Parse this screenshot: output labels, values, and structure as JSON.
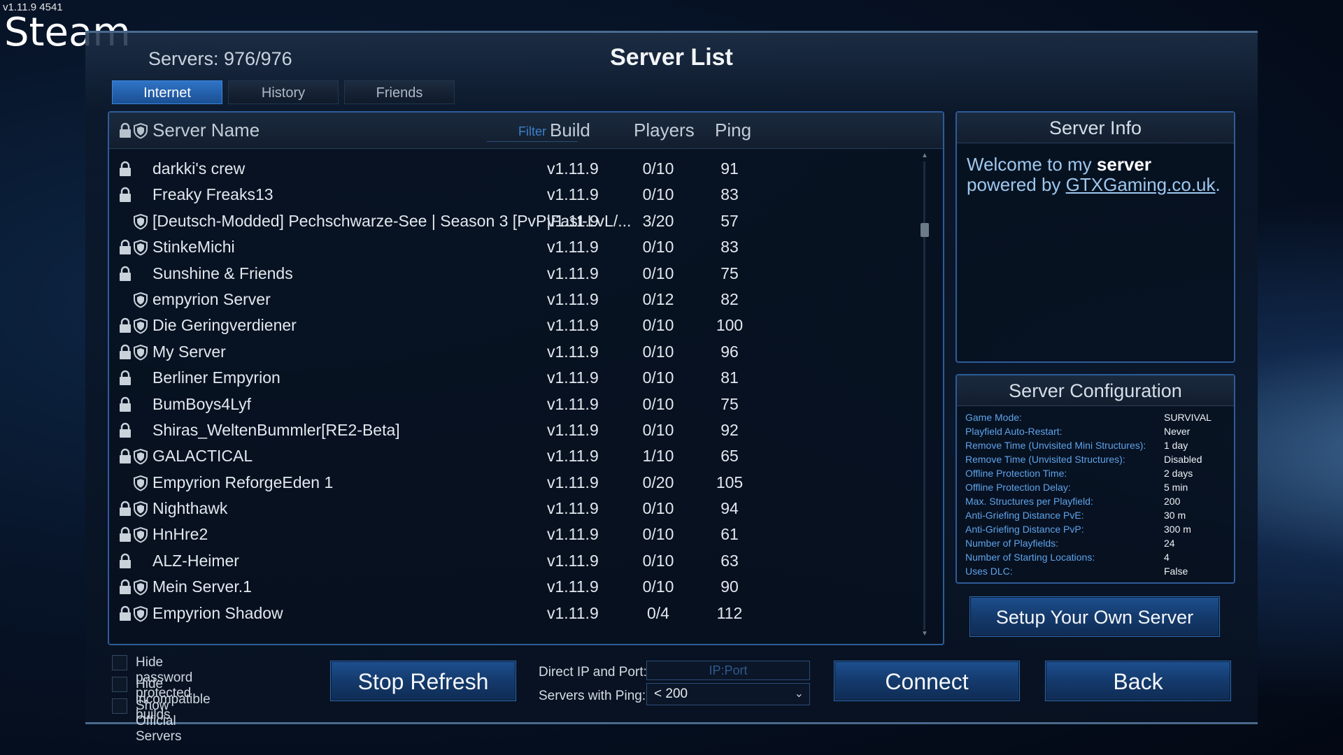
{
  "app": {
    "version": "v1.11.9 4541",
    "overlay_title": "Steam"
  },
  "header": {
    "servers_count": "Servers: 976/976",
    "title": "Server List"
  },
  "tabs": [
    {
      "label": "Internet",
      "active": true
    },
    {
      "label": "History",
      "active": false
    },
    {
      "label": "Friends",
      "active": false
    }
  ],
  "list": {
    "columns": {
      "name": "Server Name",
      "filter_placeholder": "Filter",
      "build": "Build",
      "players": "Players",
      "ping": "Ping"
    },
    "rows": [
      {
        "locked": true,
        "shield": false,
        "name": "darkki's crew",
        "build": "v1.11.9",
        "players": "0/10",
        "ping": "91"
      },
      {
        "locked": true,
        "shield": false,
        "name": "Freaky Freaks13",
        "build": "v1.11.9",
        "players": "0/10",
        "ping": "83"
      },
      {
        "locked": false,
        "shield": true,
        "name": "[Deutsch-Modded] Pechschwarze-See | Season 3 [PvP|Fast-LvL/...",
        "build": "v1.11.9",
        "players": "3/20",
        "ping": "57"
      },
      {
        "locked": true,
        "shield": true,
        "name": "StinkeMichi",
        "build": "v1.11.9",
        "players": "0/10",
        "ping": "83"
      },
      {
        "locked": true,
        "shield": false,
        "name": "Sunshine & Friends",
        "build": "v1.11.9",
        "players": "0/10",
        "ping": "75"
      },
      {
        "locked": false,
        "shield": true,
        "name": "empyrion Server",
        "build": "v1.11.9",
        "players": "0/12",
        "ping": "82"
      },
      {
        "locked": true,
        "shield": true,
        "name": "Die Geringverdiener",
        "build": "v1.11.9",
        "players": "0/10",
        "ping": "100"
      },
      {
        "locked": true,
        "shield": true,
        "name": "My Server",
        "build": "v1.11.9",
        "players": "0/10",
        "ping": "96"
      },
      {
        "locked": true,
        "shield": false,
        "name": "Berliner Empyrion",
        "build": "v1.11.9",
        "players": "0/10",
        "ping": "81"
      },
      {
        "locked": true,
        "shield": false,
        "name": "BumBoys4Lyf",
        "build": "v1.11.9",
        "players": "0/10",
        "ping": "75"
      },
      {
        "locked": true,
        "shield": false,
        "name": "Shiras_WeltenBummler[RE2-Beta]",
        "build": "v1.11.9",
        "players": "0/10",
        "ping": "92"
      },
      {
        "locked": true,
        "shield": true,
        "name": "GALACTICAL",
        "build": "v1.11.9",
        "players": "1/10",
        "ping": "65"
      },
      {
        "locked": false,
        "shield": true,
        "name": "Empyrion ReforgeEden 1",
        "build": "v1.11.9",
        "players": "0/20",
        "ping": "105"
      },
      {
        "locked": true,
        "shield": true,
        "name": "Nighthawk",
        "build": "v1.11.9",
        "players": "0/10",
        "ping": "94"
      },
      {
        "locked": true,
        "shield": true,
        "name": "HnHre2",
        "build": "v1.11.9",
        "players": "0/10",
        "ping": "61"
      },
      {
        "locked": true,
        "shield": false,
        "name": "ALZ-Heimer",
        "build": "v1.11.9",
        "players": "0/10",
        "ping": "63"
      },
      {
        "locked": true,
        "shield": true,
        "name": "Mein Server.1",
        "build": "v1.11.9",
        "players": "0/10",
        "ping": "90"
      },
      {
        "locked": true,
        "shield": true,
        "name": "Empyrion Shadow",
        "build": "v1.11.9",
        "players": "0/4",
        "ping": "112"
      }
    ]
  },
  "server_info": {
    "title": "Server Info",
    "welcome_pre": "Welcome to my ",
    "welcome_bold": "server",
    "welcome_mid": " powered by ",
    "welcome_link": "GTXGaming.co.uk",
    "welcome_post": "."
  },
  "server_config": {
    "title": "Server Configuration",
    "items": [
      {
        "key": "Game Mode:",
        "value": "SURVIVAL"
      },
      {
        "key": "Playfield Auto-Restart:",
        "value": "Never"
      },
      {
        "key": "Remove Time (Unvisited Mini Structures):",
        "value": "1 day"
      },
      {
        "key": "Remove Time (Unvisited Structures):",
        "value": "Disabled"
      },
      {
        "key": "Offline Protection Time:",
        "value": "2 days"
      },
      {
        "key": "Offline Protection Delay:",
        "value": "5 min"
      },
      {
        "key": "Max. Structures per Playfield:",
        "value": "200"
      },
      {
        "key": "Anti-Griefing Distance PvE:",
        "value": "30 m"
      },
      {
        "key": "Anti-Griefing Distance PvP:",
        "value": "300 m"
      },
      {
        "key": "Number of Playfields:",
        "value": "24"
      },
      {
        "key": "Number of Starting Locations:",
        "value": "4"
      },
      {
        "key": "Uses DLC:",
        "value": "False"
      }
    ]
  },
  "buttons": {
    "setup": "Setup Your Own Server",
    "stop_refresh": "Stop Refresh",
    "connect": "Connect",
    "back": "Back"
  },
  "filters": {
    "hide_password": "Hide password protected",
    "hide_incompatible": "Hide incompatible builds",
    "show_official": "Show Official Servers"
  },
  "direct": {
    "ip_label": "Direct IP and Port:",
    "ip_placeholder": "IP:Port",
    "ping_label": "Servers with Ping:",
    "ping_value": "< 200"
  },
  "colors": {
    "accent": "#2f74c7",
    "panel_border": "#2e5c9a",
    "config_key": "#5fa3ea"
  },
  "icons": {
    "lock": "lock-icon",
    "shield": "shield-icon",
    "dropdown": "chevron-down-icon"
  }
}
